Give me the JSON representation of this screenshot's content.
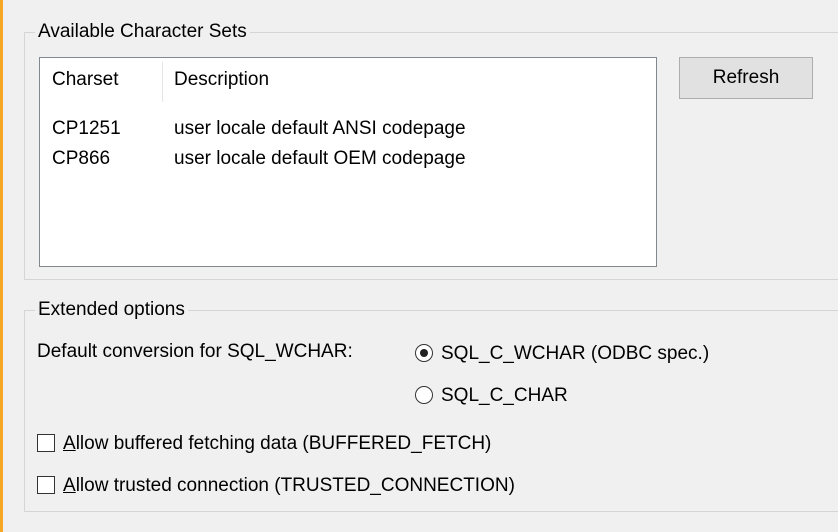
{
  "charsets_group": {
    "title": "Available Character Sets",
    "columns": [
      "Charset",
      "Description"
    ],
    "rows": [
      {
        "charset": "CP1251",
        "description": "user locale default ANSI codepage"
      },
      {
        "charset": "CP866",
        "description": "user locale default OEM codepage"
      }
    ],
    "refresh_label": "Refresh"
  },
  "extended_group": {
    "title": "Extended options",
    "conversion_label": "Default conversion for SQL_WCHAR:",
    "radio_options": [
      {
        "label": "SQL_C_WCHAR (ODBC spec.)",
        "selected": true
      },
      {
        "label": "SQL_C_CHAR",
        "selected": false
      }
    ],
    "checkboxes": [
      {
        "accel": "A",
        "rest": "llow buffered fetching data (BUFFERED_FETCH)",
        "checked": false
      },
      {
        "accel": "A",
        "rest": "llow trusted connection (TRUSTED_CONNECTION)",
        "checked": false
      }
    ]
  },
  "colors": {
    "accent_left": "#f5a623",
    "window_bg": "#f0f0f0",
    "listview_border": "#828790"
  }
}
